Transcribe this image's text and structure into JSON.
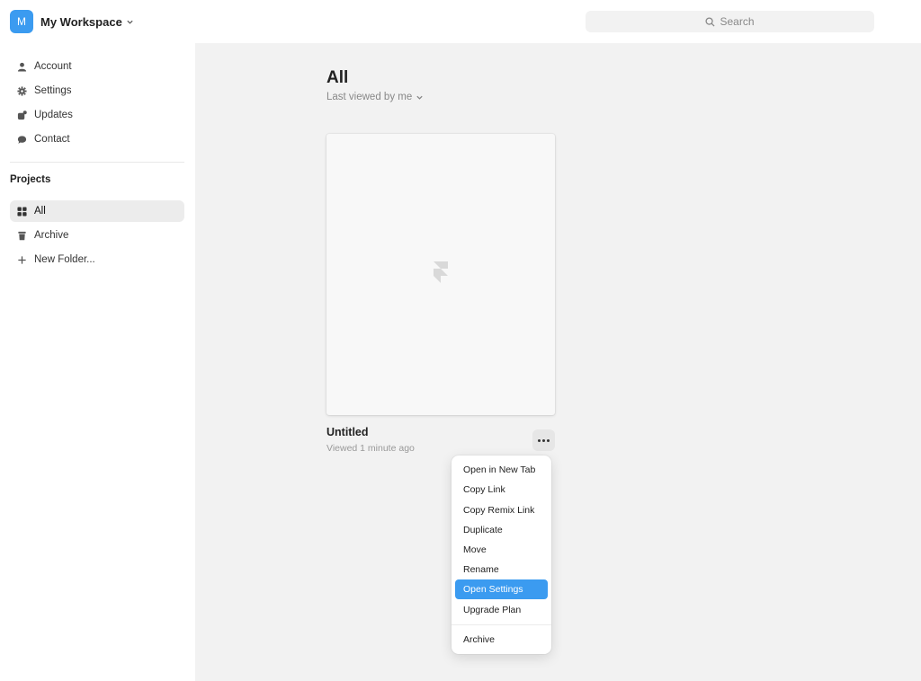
{
  "workspace": {
    "avatar_letter": "M",
    "name": "My Workspace"
  },
  "search": {
    "placeholder": "Search"
  },
  "sidebar": {
    "items": [
      {
        "label": "Account",
        "icon": "person-icon"
      },
      {
        "label": "Settings",
        "icon": "gear-icon"
      },
      {
        "label": "Updates",
        "icon": "updates-icon"
      },
      {
        "label": "Contact",
        "icon": "chat-icon"
      }
    ],
    "projects_title": "Projects",
    "projects": [
      {
        "label": "All",
        "icon": "grid-icon",
        "active": true
      },
      {
        "label": "Archive",
        "icon": "trash-icon"
      },
      {
        "label": "New Folder...",
        "icon": "plus-icon"
      }
    ]
  },
  "main": {
    "title": "All",
    "sort_label": "Last viewed by me",
    "card": {
      "title": "Untitled",
      "subtitle": "Viewed 1 minute ago",
      "icon": "framer-logo-icon"
    }
  },
  "context_menu": {
    "items": [
      "Open in New Tab",
      "Copy Link",
      "Copy Remix Link",
      "Duplicate",
      "Move",
      "Rename",
      "Open Settings",
      "Upgrade Plan"
    ],
    "highlighted": "Open Settings",
    "footer_item": "Archive"
  },
  "colors": {
    "accent": "#3b9bf0",
    "background": "#f2f2f2",
    "sidebar": "#ffffff"
  }
}
